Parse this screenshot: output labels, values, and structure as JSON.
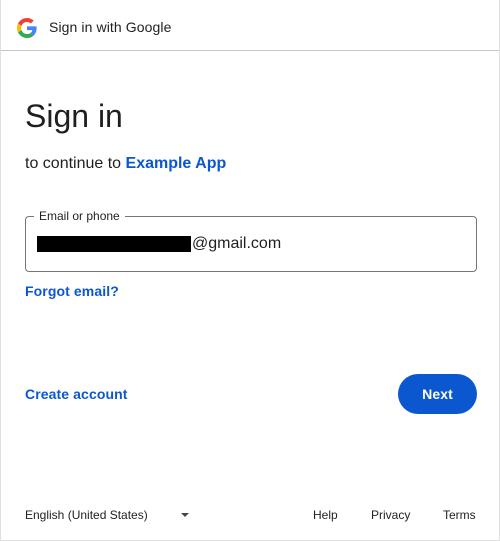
{
  "header": {
    "title": "Sign in with Google",
    "logo_icon": "google-g-icon"
  },
  "main": {
    "heading": "Sign in",
    "subheading_prefix": "to continue to ",
    "app_name": "Example App",
    "email_field": {
      "label": "Email or phone",
      "value_suffix": "@gmail.com"
    },
    "forgot_email": "Forgot email?",
    "create_account": "Create account",
    "next_button": "Next"
  },
  "footer": {
    "language": "English (United States)",
    "help": "Help",
    "privacy": "Privacy",
    "terms": "Terms"
  },
  "colors": {
    "accent": "#0b57d0",
    "text": "#1f1f1f",
    "border": "#747775"
  }
}
